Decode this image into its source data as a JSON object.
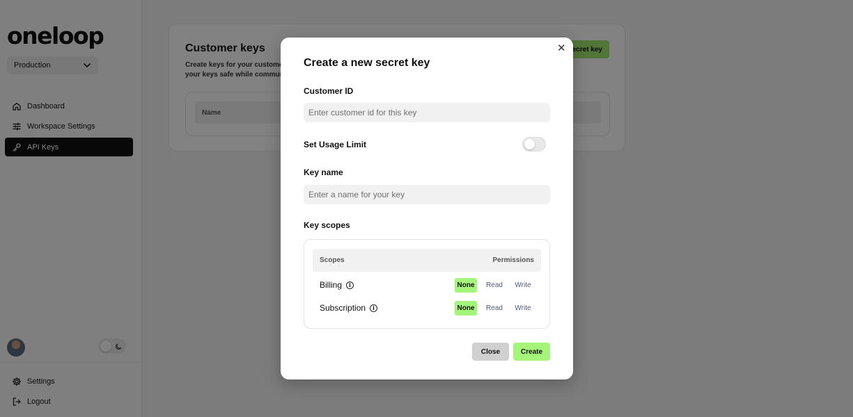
{
  "sidebar": {
    "logo": "oneloop",
    "environment": "Production",
    "nav": [
      {
        "label": "Dashboard",
        "icon": "home-icon"
      },
      {
        "label": "Workspace Settings",
        "icon": "sliders-icon"
      },
      {
        "label": "API Keys",
        "icon": "key-icon",
        "active": true
      }
    ],
    "bottom": [
      {
        "label": "Settings",
        "icon": "gear-icon"
      },
      {
        "label": "Logout",
        "icon": "logout-icon"
      }
    ]
  },
  "main": {
    "title": "Customer keys",
    "description_line1": "Create keys for your custome",
    "description_line2": "your keys safe while commun",
    "new_key_button": "ecret key",
    "table_header_name": "Name"
  },
  "modal": {
    "title": "Create a new secret key",
    "customer_id_label": "Customer ID",
    "customer_id_placeholder": "Enter customer id for this key",
    "customer_id_value": "",
    "usage_limit_label": "Set Usage Limit",
    "usage_limit_enabled": false,
    "key_name_label": "Key name",
    "key_name_placeholder": "Enter a name for your key",
    "key_name_value": "",
    "key_scopes_label": "Key scopes",
    "scopes_header": "Scopes",
    "permissions_header": "Permissions",
    "scopes": [
      {
        "name": "Billing",
        "selected": "None",
        "options": [
          "None",
          "Read",
          "Write"
        ]
      },
      {
        "name": "Subscription",
        "selected": "None",
        "options": [
          "None",
          "Read",
          "Write"
        ]
      }
    ],
    "close_button": "Close",
    "create_button": "Create"
  },
  "colors": {
    "accent_green": "#a5f57a",
    "active_nav_bg": "#111111"
  }
}
